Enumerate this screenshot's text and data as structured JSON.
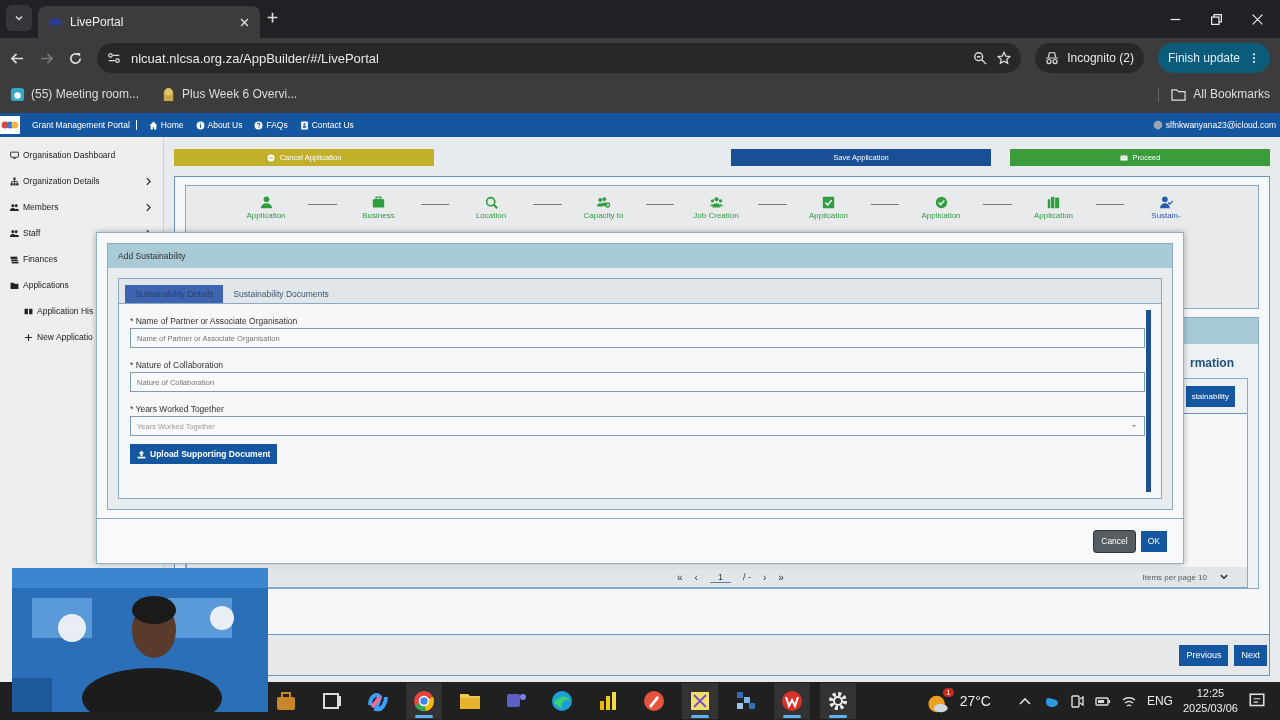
{
  "browser": {
    "tab_title": "LivePortal",
    "url": "nlcuat.nlcsa.org.za/AppBuilder/#/LivePortal",
    "profile": "Incognito (2)",
    "update_button": "Finish update",
    "bookmarks": [
      "(55) Meeting room...",
      "Plus Week 6 Overvi..."
    ],
    "all_bookmarks": "All Bookmarks"
  },
  "navbar": {
    "brand": "Grant Management Portal",
    "links": [
      "Home",
      "About Us",
      "FAQs",
      "Contact Us"
    ],
    "user": "slfnkwanyana23@icloud.com"
  },
  "sidebar": [
    {
      "label": "Organisation Dashboard",
      "expandable": false
    },
    {
      "label": "Organization Details",
      "expandable": true
    },
    {
      "label": "Members",
      "expandable": true
    },
    {
      "label": "Staff",
      "expandable": true
    },
    {
      "label": "Finances"
    },
    {
      "label": "Applications",
      "children": [
        {
          "label": "Application His"
        },
        {
          "label": "New Applicatio"
        }
      ]
    }
  ],
  "actions": [
    {
      "label": "Cancel Application",
      "kind": "cancel"
    },
    {
      "label": "Save Application",
      "kind": "save"
    },
    {
      "label": "Proceed",
      "kind": "proceed"
    }
  ],
  "steps": [
    {
      "label": "Application",
      "current": false
    },
    {
      "label": "Business",
      "current": false
    },
    {
      "label": "Location",
      "current": false
    },
    {
      "label": "Capacity to",
      "current": false
    },
    {
      "label": "Job Creation",
      "current": false
    },
    {
      "label": "Application",
      "current": false
    },
    {
      "label": "Application",
      "current": false
    },
    {
      "label": "Application",
      "current": false
    },
    {
      "label": "Sustain-",
      "current": true
    }
  ],
  "info_panel": {
    "title": "rmation",
    "button": "stainability",
    "pagination": {
      "first": "«",
      "prev": "‹",
      "page": "1",
      "of": "/ -",
      "next": "›",
      "last": "»"
    },
    "items_per_page": "Items per page 10"
  },
  "footer_buttons": [
    "Previous",
    "Next"
  ],
  "modal": {
    "title": "Add Sustainability",
    "tabs": [
      {
        "label": "Sustainability Details",
        "selected": true
      },
      {
        "label": "Sustainability Documents",
        "selected": false
      }
    ],
    "fields": [
      {
        "label": "* Name of Partner or Associate Organisation",
        "placeholder": "Name of Partner or Associate Organisation",
        "kind": "text"
      },
      {
        "label": "* Nature of Collaboration",
        "placeholder": "Nature of Collaboration",
        "kind": "text"
      },
      {
        "label": "* Years Worked Together",
        "placeholder": "Years Worked Together",
        "kind": "select"
      }
    ],
    "upload_button": "Upload Supporting Document",
    "buttons": [
      {
        "label": "Cancel",
        "kind": "secondary"
      },
      {
        "label": "OK",
        "kind": "primary"
      }
    ]
  },
  "taskbar": {
    "apps": [
      {
        "active": false
      },
      {
        "active": false
      },
      {
        "active": false
      },
      {
        "active": true
      },
      {
        "active": false
      },
      {
        "active": false
      },
      {
        "active": false
      },
      {
        "active": false
      },
      {
        "active": false
      },
      {
        "active": true
      },
      {
        "active": false
      },
      {
        "active": true
      },
      {
        "active": true
      }
    ],
    "weather": {
      "temp": "27°C",
      "badge": "1"
    },
    "language": "ENG",
    "time": "12:25",
    "date": "2025/03/06"
  }
}
